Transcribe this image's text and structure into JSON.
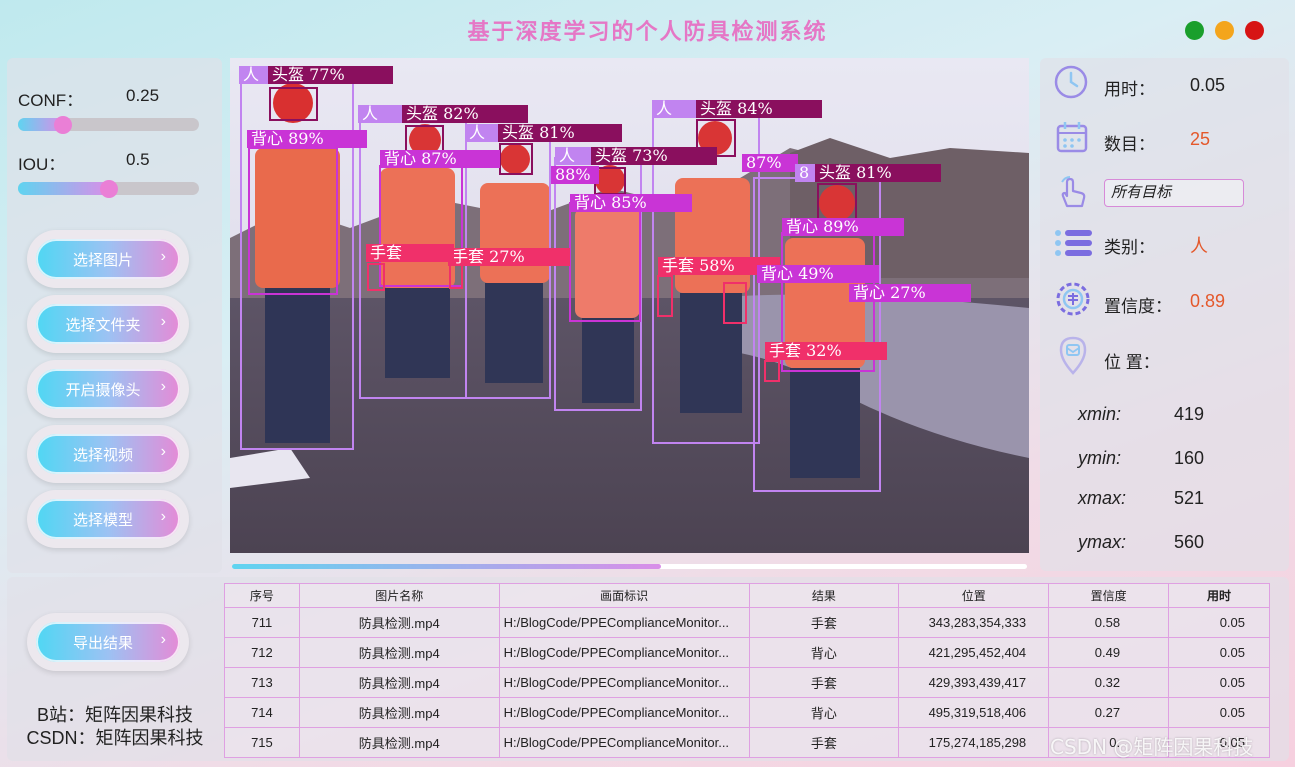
{
  "app": {
    "title": "基于深度学习的个人防具检测系统"
  },
  "params": {
    "conf_label": "CONF：",
    "conf_value": "0.25",
    "conf_level": 0.25,
    "iou_label": "IOU：",
    "iou_value": "0.5",
    "iou_level": 0.5
  },
  "buttons": {
    "select_image": "选择图片",
    "select_folder": "选择文件夹",
    "open_camera": "开启摄像头",
    "select_video": "选择视频",
    "select_model": "选择模型",
    "export_results": "导出结果"
  },
  "credits": {
    "bilibili": "B站：矩阵因果科技",
    "csdn": "CSDN：矩阵因果科技"
  },
  "video": {
    "progress": 0.54,
    "detections": [
      {
        "label": "人"
      },
      {
        "label": "头盔 77%"
      },
      {
        "label": "背心 89%"
      },
      {
        "label": "人"
      },
      {
        "label": "头盔 82%"
      },
      {
        "label": "背心 87%"
      },
      {
        "label": "人"
      },
      {
        "label": "头盔 81%"
      },
      {
        "label": "手套 27%"
      },
      {
        "label": "手套"
      },
      {
        "label": "人"
      },
      {
        "label": "头盔 73%"
      },
      {
        "label": "88%"
      },
      {
        "label": "背心 85%"
      },
      {
        "label": "人"
      },
      {
        "label": "头盔 84%"
      },
      {
        "label": "87%"
      },
      {
        "label": "手套 58%"
      },
      {
        "label": "8"
      },
      {
        "label": "头盔 81%"
      },
      {
        "label": "背心 89%"
      },
      {
        "label": "背心 49%"
      },
      {
        "label": "背心 27%"
      },
      {
        "label": "手套 32%"
      }
    ]
  },
  "info": {
    "time_label": "用时：",
    "time_value": "0.05",
    "count_label": "数目：",
    "count_value": "25",
    "target_select": "所有目标",
    "class_label": "类别：",
    "class_value": "人",
    "conf_label": "置信度：",
    "conf_value": "0.89",
    "position_label": "位 置：",
    "xmin_label": "xmin:",
    "xmin_value": "419",
    "ymin_label": "ymin:",
    "ymin_value": "160",
    "xmax_label": "xmax:",
    "xmax_value": "521",
    "ymax_label": "ymax:",
    "ymax_value": "560"
  },
  "table": {
    "headers": [
      "序号",
      "图片名称",
      "画面标识",
      "结果",
      "位置",
      "置信度",
      "用时"
    ],
    "rows": [
      [
        "711",
        "防具检测.mp4",
        "H:/BlogCode/PPEComplianceMonitor...",
        "手套",
        "343,283,354,333",
        "0.58",
        "0.05"
      ],
      [
        "712",
        "防具检测.mp4",
        "H:/BlogCode/PPEComplianceMonitor...",
        "背心",
        "421,295,452,404",
        "0.49",
        "0.05"
      ],
      [
        "713",
        "防具检测.mp4",
        "H:/BlogCode/PPEComplianceMonitor...",
        "手套",
        "429,393,439,417",
        "0.32",
        "0.05"
      ],
      [
        "714",
        "防具检测.mp4",
        "H:/BlogCode/PPEComplianceMonitor...",
        "背心",
        "495,319,518,406",
        "0.27",
        "0.05"
      ],
      [
        "715",
        "防具检测.mp4",
        "H:/BlogCode/PPEComplianceMonitor...",
        "手套",
        "175,274,185,298",
        "0.",
        "0.05"
      ]
    ]
  },
  "watermark": "CSDN @矩阵因果科技",
  "colors": {
    "title": "#e577c6",
    "accent_orange": "#e4582b",
    "person_box": "#c184f0",
    "helmet_box": "#8a0f5e",
    "vest_box": "#c934d6",
    "glove_box": "#f0306a"
  }
}
